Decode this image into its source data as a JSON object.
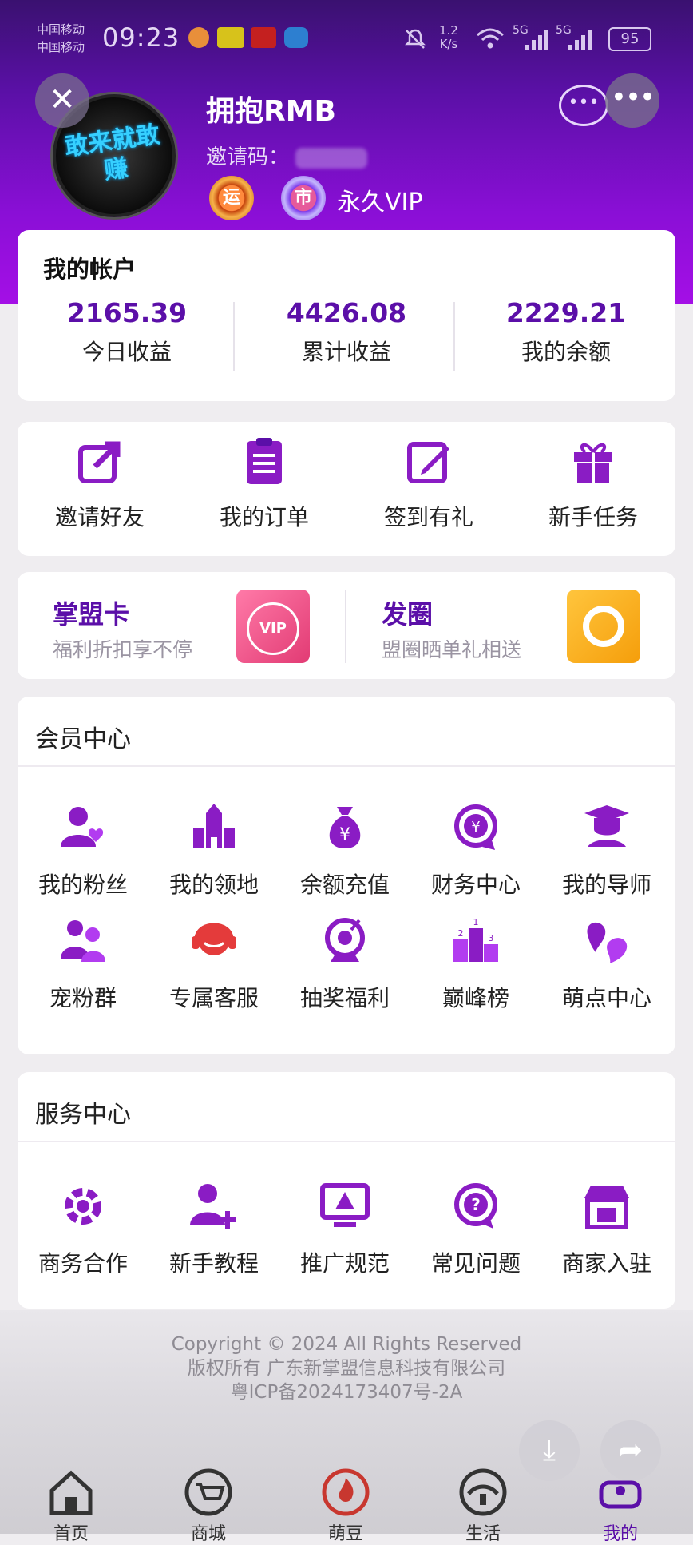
{
  "status_bar": {
    "carrier1": "中国移动",
    "carrier2": "中国移动",
    "time": "09:23",
    "net_speed_value": "1.2",
    "net_speed_unit": "K/s",
    "signal1": "5G",
    "signal2": "5G",
    "battery": "95"
  },
  "profile": {
    "avatar_text": "敢来就敢赚",
    "username": "拥抱RMB",
    "invite_label": "邀请码：",
    "badge1": "运",
    "badge2": "市",
    "vip_label": "永久VIP"
  },
  "account": {
    "title": "我的帐户",
    "stats": [
      {
        "value": "2165.39",
        "label": "今日收益"
      },
      {
        "value": "4426.08",
        "label": "累计收益"
      },
      {
        "value": "2229.21",
        "label": "我的余额"
      }
    ]
  },
  "quick_actions": [
    {
      "label": "邀请好友",
      "icon": "share-icon"
    },
    {
      "label": "我的订单",
      "icon": "order-list-icon"
    },
    {
      "label": "签到有礼",
      "icon": "edit-icon"
    },
    {
      "label": "新手任务",
      "icon": "gift-icon"
    }
  ],
  "promos": [
    {
      "title": "掌盟卡",
      "subtitle": "福利折扣享不停",
      "badge": "VIP",
      "icon": "vip-card-icon"
    },
    {
      "title": "发圈",
      "subtitle": "盟圈晒单礼相送",
      "icon": "camera-shutter-icon"
    }
  ],
  "member_center": {
    "title": "会员中心",
    "items": [
      {
        "label": "我的粉丝",
        "icon": "fans-icon"
      },
      {
        "label": "我的领地",
        "icon": "castle-icon"
      },
      {
        "label": "余额充值",
        "icon": "money-bag-icon"
      },
      {
        "label": "财务中心",
        "icon": "finance-icon"
      },
      {
        "label": "我的导师",
        "icon": "mentor-icon"
      },
      {
        "label": "宠粉群",
        "icon": "group-icon"
      },
      {
        "label": "专属客服",
        "icon": "customer-service-icon"
      },
      {
        "label": "抽奖福利",
        "icon": "lottery-icon"
      },
      {
        "label": "巅峰榜",
        "icon": "ranking-icon"
      },
      {
        "label": "萌点中心",
        "icon": "points-icon"
      }
    ]
  },
  "service_center": {
    "title": "服务中心",
    "items": [
      {
        "label": "商务合作",
        "icon": "handshake-icon"
      },
      {
        "label": "新手教程",
        "icon": "add-user-icon"
      },
      {
        "label": "推广规范",
        "icon": "warning-monitor-icon"
      },
      {
        "label": "常见问题",
        "icon": "question-icon"
      },
      {
        "label": "商家入驻",
        "icon": "store-icon"
      }
    ]
  },
  "footer": {
    "copyright": "Copyright © 2024 All Rights Reserved",
    "owner": "版权所有 广东新掌盟信息科技有限公司",
    "icp": "粤ICP备2024173407号-2A"
  },
  "tabs": [
    {
      "label": "首页",
      "icon": "home-icon"
    },
    {
      "label": "商城",
      "icon": "cart-icon"
    },
    {
      "label": "萌豆",
      "icon": "flame-icon"
    },
    {
      "label": "生活",
      "icon": "life-icon"
    },
    {
      "label": "我的",
      "icon": "profile-icon"
    }
  ],
  "colors": {
    "accent": "#5b0fa8",
    "icon_purple": "#8a1cc4",
    "header_top": "#3a1170",
    "header_bottom": "#a40fe6"
  }
}
